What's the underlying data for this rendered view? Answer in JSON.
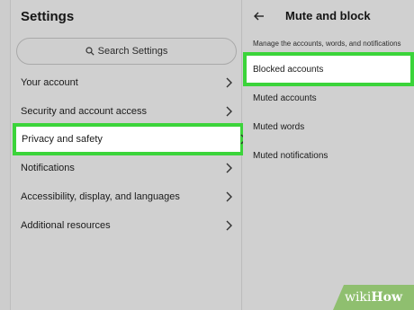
{
  "settings": {
    "title": "Settings",
    "search_placeholder": "Search Settings",
    "items": [
      {
        "label": "Your account"
      },
      {
        "label": "Security and account access"
      },
      {
        "label": "Privacy and safety"
      },
      {
        "label": "Notifications"
      },
      {
        "label": "Accessibility, display, and languages"
      },
      {
        "label": "Additional resources"
      }
    ]
  },
  "mute_block": {
    "title": "Mute and block",
    "description": "Manage the accounts, words, and notifications",
    "items": [
      {
        "label": "Blocked accounts"
      },
      {
        "label": "Muted accounts"
      },
      {
        "label": "Muted words"
      },
      {
        "label": "Muted notifications"
      }
    ]
  },
  "watermark": {
    "part1": "wiki",
    "part2": "How"
  },
  "colors": {
    "highlight_border": "#3bd43a",
    "watermark_bg": "#8fbf6f"
  }
}
